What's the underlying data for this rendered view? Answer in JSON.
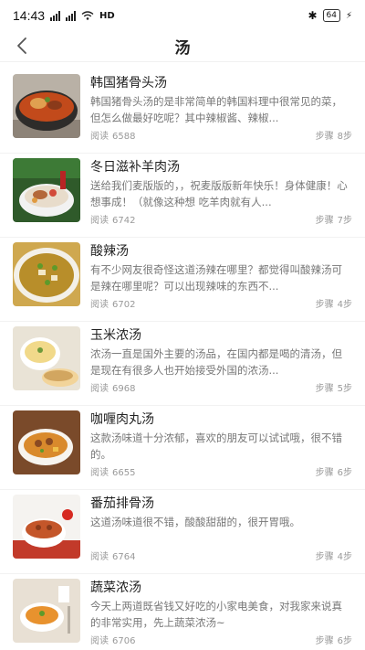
{
  "status_bar": {
    "time": "14:43",
    "network": "HD",
    "battery": "64"
  },
  "header": {
    "title": "汤"
  },
  "recipes": [
    {
      "title": "韩国猪骨头汤",
      "desc": "韩国猪骨头汤的是非常简单的韩国料理中很常见的菜，但怎么做最好吃呢？其中辣椒酱、辣椒...",
      "read_label": "阅读",
      "reads": "6588",
      "steps_label": "步骤",
      "steps": "8步"
    },
    {
      "title": "冬日滋补羊肉汤",
      "desc": "送给我们麦版版的，，祝麦版版新年快乐！身体健康！心想事成！（就像这种想 吃羊肉就有人...",
      "read_label": "阅读",
      "reads": "6742",
      "steps_label": "步骤",
      "steps": "7步"
    },
    {
      "title": "酸辣汤",
      "desc": "有不少网友很奇怪这道汤辣在哪里？都觉得叫酸辣汤可是辣在哪里呢？可以出现辣味的东西不...",
      "read_label": "阅读",
      "reads": "6702",
      "steps_label": "步骤",
      "steps": "4步"
    },
    {
      "title": "玉米浓汤",
      "desc": "浓汤一直是国外主要的汤品，在国内都是喝的清汤，但是现在有很多人也开始接受外国的浓汤...",
      "read_label": "阅读",
      "reads": "6968",
      "steps_label": "步骤",
      "steps": "5步"
    },
    {
      "title": "咖喱肉丸汤",
      "desc": "这款汤味道十分浓郁，喜欢的朋友可以试试哦，很不错的。",
      "read_label": "阅读",
      "reads": "6655",
      "steps_label": "步骤",
      "steps": "6步"
    },
    {
      "title": "番茄排骨汤",
      "desc": "这道汤味道很不错，酸酸甜甜的，很开胃哦。",
      "read_label": "阅读",
      "reads": "6764",
      "steps_label": "步骤",
      "steps": "4步"
    },
    {
      "title": "蔬菜浓汤",
      "desc": "今天上两道既省钱又好吃的小家电美食，对我家来说真的非常实用，先上蔬菜浓汤~",
      "read_label": "阅读",
      "reads": "6706",
      "steps_label": "步骤",
      "steps": "6步"
    }
  ]
}
